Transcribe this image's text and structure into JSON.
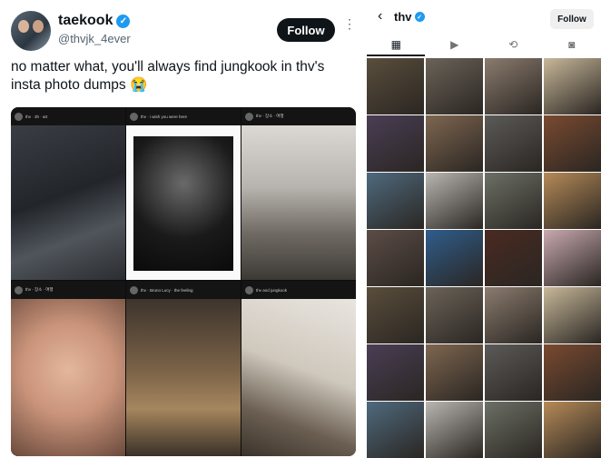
{
  "tweet": {
    "username": "taekook",
    "handle": "@thvjk_4ever",
    "follow_label": "Follow",
    "more_label": "⋮",
    "text": "no matter what, you'll always find jungkook in thv's insta photo dumps 😭",
    "collage_captions": [
      "thv · 3h · art",
      "thv · i wish you were here",
      "thv · 장소 · 여행",
      "thv · 장소 · 여행",
      "thv · Bruno Lucy · the feeling",
      "thv and jungkook"
    ],
    "verified_glyph": "✓"
  },
  "profile": {
    "back_glyph": "‹",
    "username": "thv",
    "follow_label": "Follow",
    "verified_glyph": "✓",
    "tabs": [
      {
        "name": "grid",
        "glyph": "▦"
      },
      {
        "name": "reels",
        "glyph": "▶"
      },
      {
        "name": "reposts",
        "glyph": "⟲"
      },
      {
        "name": "tagged",
        "glyph": "◙"
      }
    ]
  },
  "colors": {
    "verified": "#1d9bf0",
    "follow_bg": "#0f1419",
    "grid_tiles": [
      "#5a4e3c",
      "#6b6358",
      "#8b7b6e",
      "#c8b89a",
      "#4a3e55",
      "#7e6650",
      "#5c5a58",
      "#7a4a30",
      "#4f6a7e",
      "#b9b6b2",
      "#6c7065",
      "#b58a58",
      "#5c4c46",
      "#2f5d8c",
      "#4a2a22",
      "#c9a9b0",
      "#5a4e3c",
      "#6b6358",
      "#8b7b6e",
      "#c8b89a",
      "#4a3e55",
      "#7e6650",
      "#5c5a58",
      "#7a4a30",
      "#4f6a7e",
      "#b9b6b2",
      "#6c7065",
      "#b58a58"
    ]
  }
}
